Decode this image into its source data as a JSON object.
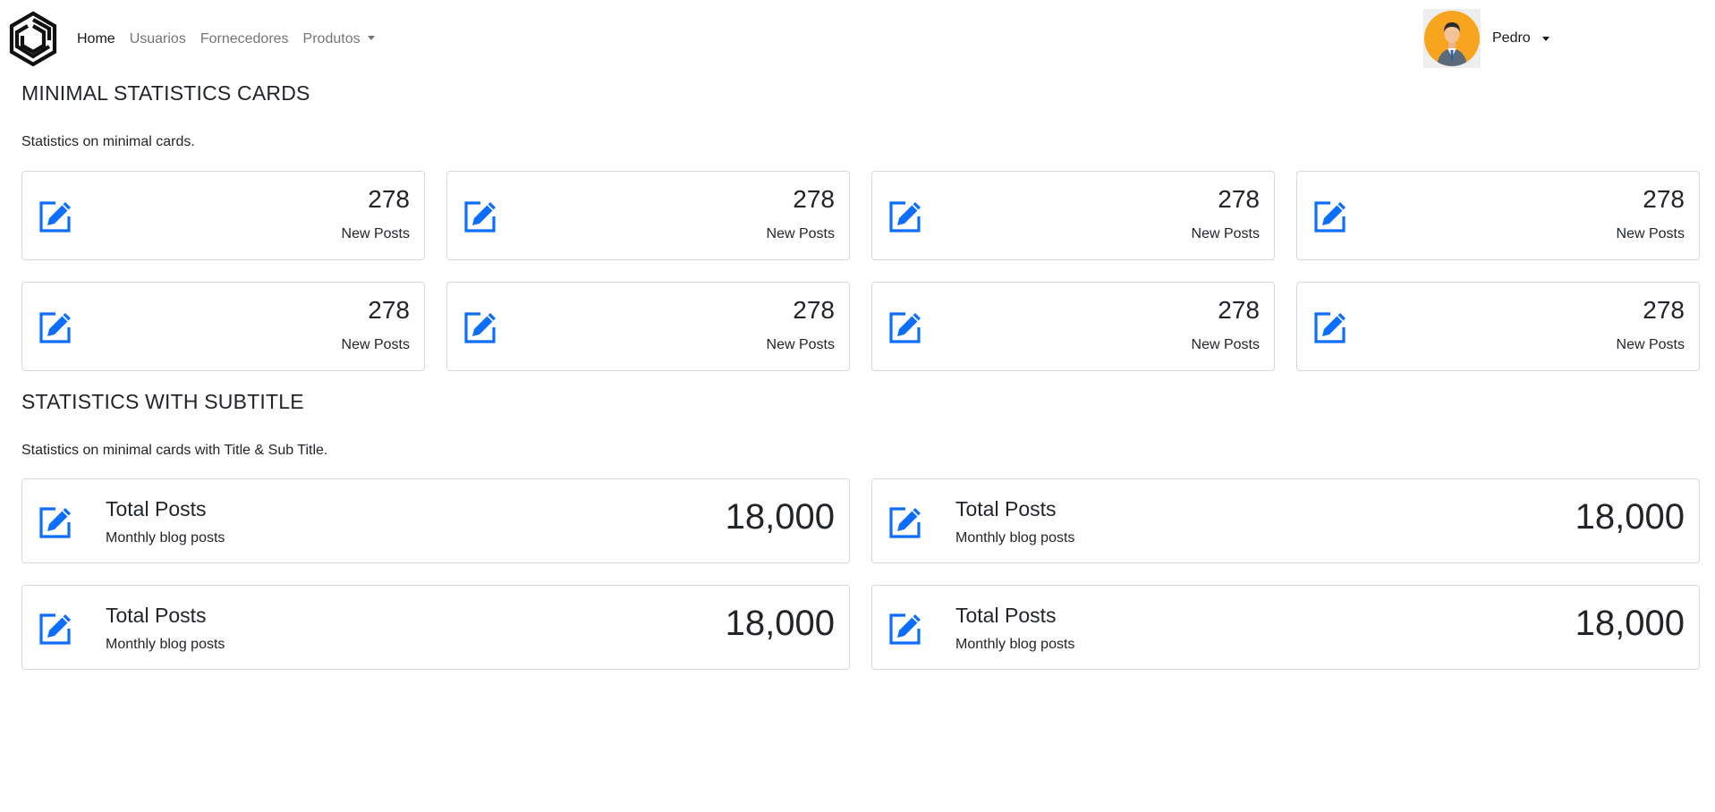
{
  "nav": {
    "links": [
      {
        "label": "Home"
      },
      {
        "label": "Usuarios"
      },
      {
        "label": "Fornecedores"
      },
      {
        "label": "Produtos"
      }
    ],
    "user_name": "Pedro"
  },
  "minimal": {
    "title": "MINIMAL STATISTICS CARDS",
    "subtitle": "Statistics on minimal cards.",
    "cards": [
      {
        "value": "278",
        "label": "New Posts",
        "icon": "edit-icon"
      },
      {
        "value": "278",
        "label": "New Posts",
        "icon": "edit-icon"
      },
      {
        "value": "278",
        "label": "New Posts",
        "icon": "edit-icon"
      },
      {
        "value": "278",
        "label": "New Posts",
        "icon": "edit-icon"
      },
      {
        "value": "278",
        "label": "New Posts",
        "icon": "edit-icon"
      },
      {
        "value": "278",
        "label": "New Posts",
        "icon": "edit-icon"
      },
      {
        "value": "278",
        "label": "New Posts",
        "icon": "edit-icon"
      },
      {
        "value": "278",
        "label": "New Posts",
        "icon": "edit-icon"
      }
    ]
  },
  "subtitled": {
    "title": "STATISTICS WITH SUBTITLE",
    "subtitle": "Statistics on minimal cards with Title & Sub Title.",
    "cards": [
      {
        "title": "Total Posts",
        "subtitle": "Monthly blog posts",
        "value": "18,000",
        "icon": "edit-icon"
      },
      {
        "title": "Total Posts",
        "subtitle": "Monthly blog posts",
        "value": "18,000",
        "icon": "edit-icon"
      },
      {
        "title": "Total Posts",
        "subtitle": "Monthly blog posts",
        "value": "18,000",
        "icon": "edit-icon"
      },
      {
        "title": "Total Posts",
        "subtitle": "Monthly blog posts",
        "value": "18,000",
        "icon": "edit-icon"
      }
    ]
  },
  "colors": {
    "accent": "#0d6efd",
    "avatar_bg": "#f7a51f",
    "card_border": "#d5d9dc"
  }
}
